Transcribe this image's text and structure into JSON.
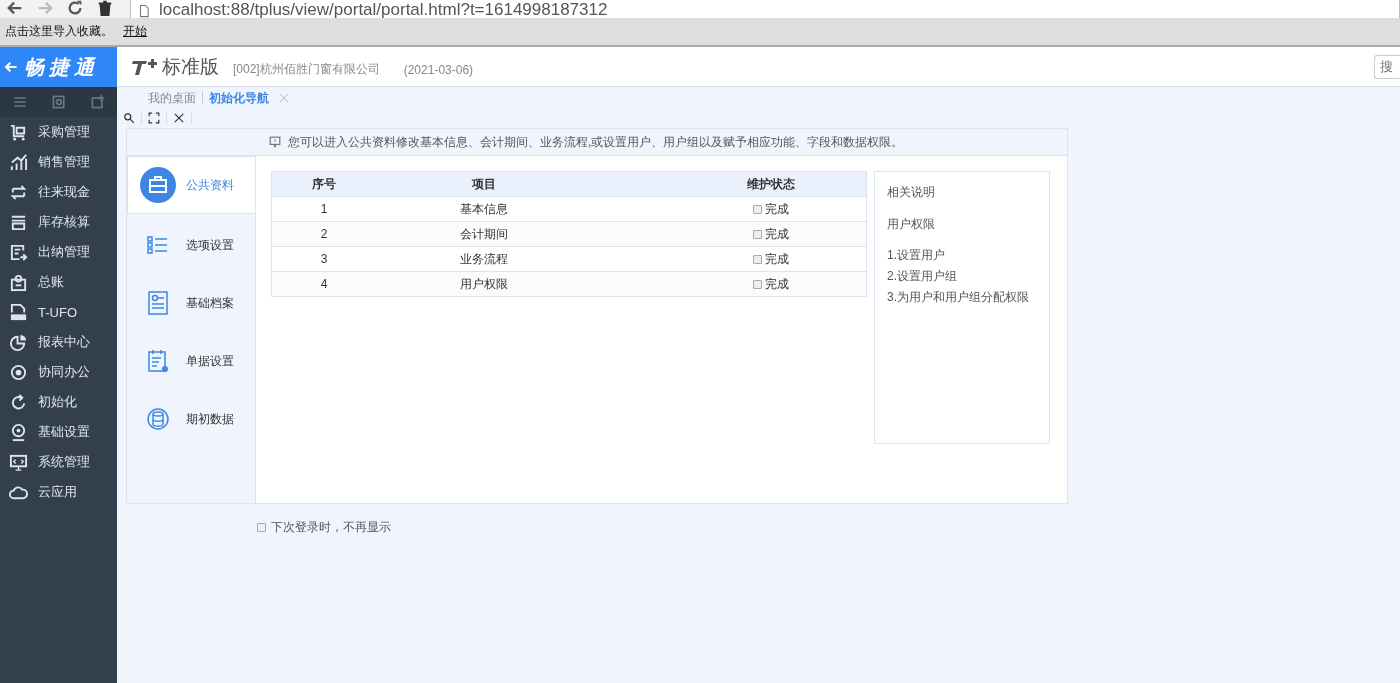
{
  "browser": {
    "address": "localhost:88/tplus/view/portal/portal.html?t=1614998187312",
    "bookmarks": [
      "点击这里导入收藏。",
      "开始"
    ]
  },
  "sidebar": {
    "logo": "畅捷通",
    "items": [
      {
        "label": "采购管理"
      },
      {
        "label": "销售管理"
      },
      {
        "label": "往来现金"
      },
      {
        "label": "库存核算"
      },
      {
        "label": "出纳管理"
      },
      {
        "label": "总账"
      },
      {
        "label": "T-UFO"
      },
      {
        "label": "报表中心"
      },
      {
        "label": "协同办公"
      },
      {
        "label": "初始化"
      },
      {
        "label": "基础设置"
      },
      {
        "label": "系统管理"
      },
      {
        "label": "云应用"
      }
    ]
  },
  "header": {
    "product": "标准版",
    "company": "[002]杭州佰胜门窗有限公司",
    "date": "(2021-03-06)",
    "search_placeholder": "搜"
  },
  "tabs": [
    {
      "label": "我的桌面",
      "selected": false
    },
    {
      "label": "初始化导航",
      "selected": true
    }
  ],
  "notice": "您可以进入公共资料修改基本信息、会计期间、业务流程,或设置用户、用户组以及赋予相应功能、字段和数据权限。",
  "nav": [
    {
      "label": "公共资料",
      "selected": true
    },
    {
      "label": "选项设置",
      "selected": false
    },
    {
      "label": "基础档案",
      "selected": false
    },
    {
      "label": "单据设置",
      "selected": false
    },
    {
      "label": "期初数据",
      "selected": false
    }
  ],
  "table": {
    "columns": [
      "序号",
      "项目",
      "维护状态"
    ],
    "rows": [
      {
        "no": "1",
        "item": "基本信息",
        "status": "完成",
        "checked": false
      },
      {
        "no": "2",
        "item": "会计期间",
        "status": "完成",
        "checked": false
      },
      {
        "no": "3",
        "item": "业务流程",
        "status": "完成",
        "checked": false
      },
      {
        "no": "4",
        "item": "用户权限",
        "status": "完成",
        "checked": false
      }
    ]
  },
  "info": {
    "title": "相关说明",
    "subtitle": "用户权限",
    "steps": [
      "1.设置用户",
      "2.设置用户组",
      "3.为用户和用户组分配权限"
    ]
  },
  "footer": {
    "label": "下次登录时，不再显示",
    "checked": false
  }
}
